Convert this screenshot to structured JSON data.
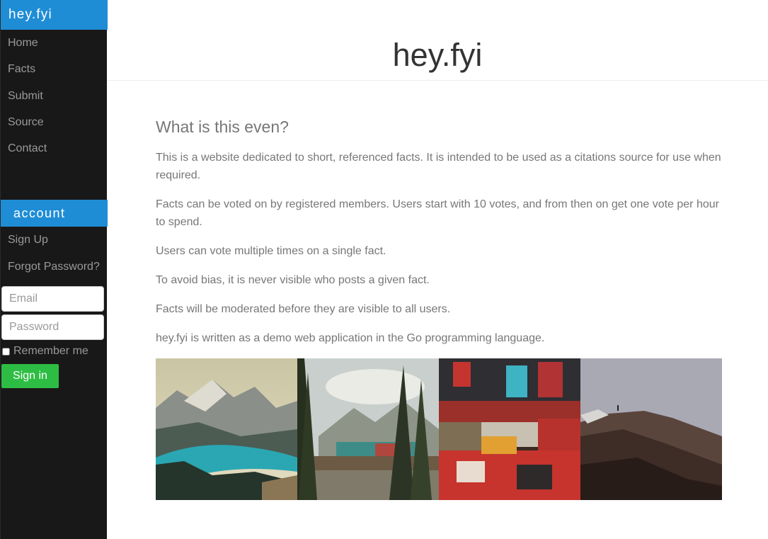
{
  "brand": "hey.fyi",
  "nav": [
    {
      "label": "Home"
    },
    {
      "label": "Facts"
    },
    {
      "label": "Submit"
    },
    {
      "label": "Source"
    },
    {
      "label": "Contact"
    }
  ],
  "account": {
    "heading": "account",
    "links": [
      {
        "label": "Sign Up"
      },
      {
        "label": "Forgot Password?"
      }
    ],
    "email_placeholder": "Email",
    "password_placeholder": "Password",
    "remember_label": "Remember me",
    "signin_label": "Sign in"
  },
  "header": {
    "title": "hey.fyi"
  },
  "main": {
    "heading": "What is this even?",
    "paragraphs": [
      "This is a website dedicated to short, referenced facts. It is intended to be used as a citations source for use when required.",
      "Facts can be voted on by registered members. Users start with 10 votes, and from then on get one vote per hour to spend.",
      "Users can vote multiple times on a single fact.",
      "To avoid bias, it is never visible who posts a given fact.",
      "Facts will be moderated before they are visible to all users.",
      "hey.fyi is written as a demo web application in the Go programming language."
    ]
  },
  "photos": [
    {
      "name": "mountain-lake-photo"
    },
    {
      "name": "forest-train-photo"
    },
    {
      "name": "shop-tshirts-photo"
    },
    {
      "name": "rocky-cliff-photo"
    }
  ],
  "colors": {
    "sidebar_bg": "#191818",
    "accent": "#1f8dd6",
    "signin_bg": "#2ebd44",
    "text_muted": "#777777"
  }
}
